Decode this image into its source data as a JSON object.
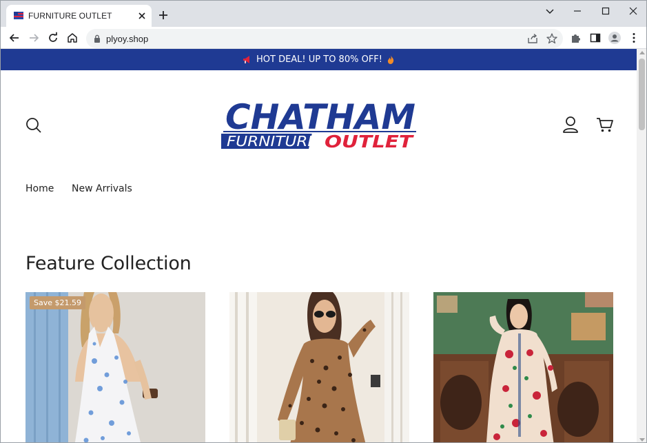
{
  "browser": {
    "tab_title": "FURNITURE OUTLET",
    "url": "plyoy.shop"
  },
  "store": {
    "announcement": "HOT DEAL! UP TO 80% OFF!",
    "announcement_icon_left": "megaphone-icon",
    "announcement_icon_right": "fire-icon",
    "logo_top": "CHATHAM",
    "logo_bottom_left": "FURNITURE",
    "logo_bottom_right": "OUTLET",
    "nav": [
      {
        "label": "Home"
      },
      {
        "label": "New Arrivals"
      }
    ],
    "section_title": "Feature Collection",
    "products": [
      {
        "badge": "Save $21.59",
        "image": "woman in white floral halter dress"
      },
      {
        "badge": "",
        "image": "woman in leopard print dress with sunglasses"
      },
      {
        "badge": "",
        "image": "woman in cream floral embroidered maxi dress"
      }
    ]
  },
  "colors": {
    "announcement_bg": "#1f3a93",
    "logo_blue": "#1f3a93",
    "logo_red": "#e0223b",
    "badge_bg": "#c49a6c"
  }
}
